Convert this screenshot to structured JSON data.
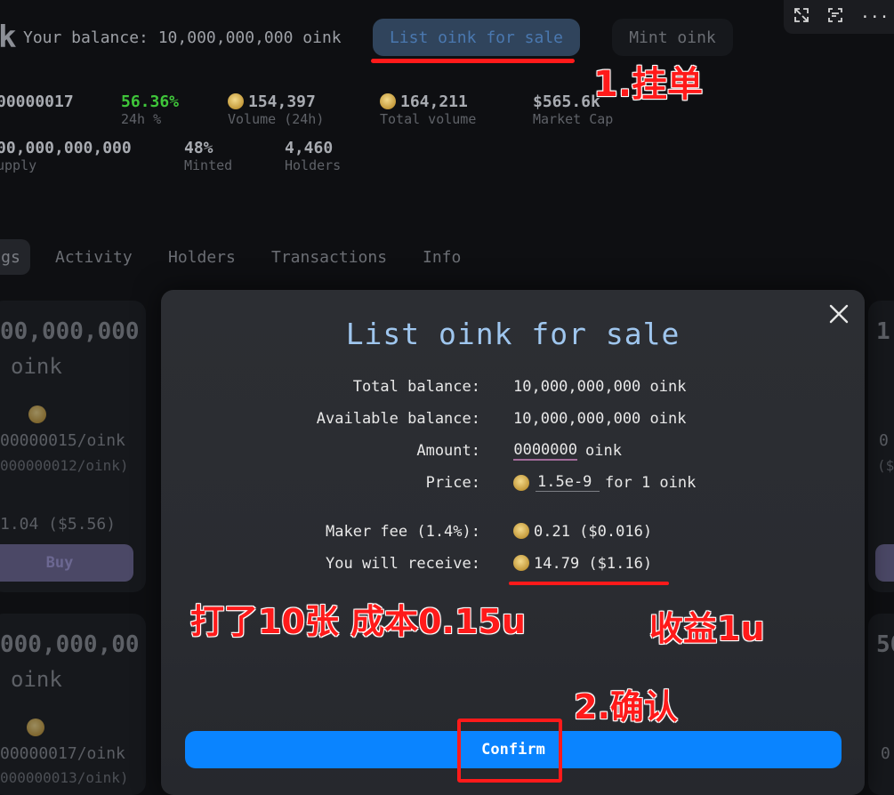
{
  "header": {
    "logo_fragment": "k",
    "balance_text": "Your balance: 10,000,000,000 oink",
    "list_button": "List oink for sale",
    "mint_button": "Mint oink"
  },
  "toolbar": {
    "icons": [
      "expand-icon",
      "scan-text-icon",
      "more-icon"
    ],
    "more_label": "···"
  },
  "stats": {
    "price": "00000017",
    "change_value": "56.36%",
    "change_label": "24h %",
    "volume_value": "154,397",
    "volume_label": "Volume (24h)",
    "total_volume_value": "164,211",
    "total_volume_label": "Total volume",
    "market_cap_value": "$565.6k",
    "market_cap_label": "Market Cap",
    "supply_value": "00,000,000,000",
    "supply_label": "upply",
    "minted_value": "48%",
    "minted_label": "Minted",
    "holders_value": "4,460",
    "holders_label": "Holders"
  },
  "tabs": [
    "gs",
    "Activity",
    "Holders",
    "Transactions",
    "Info"
  ],
  "cards": {
    "card1": {
      "amount": "00,000,000",
      "unit": "oink",
      "price": "00000015/oink",
      "price_usd": "000000012/oink)",
      "total": "1.04 ($5.56)",
      "buy": "Buy"
    },
    "card2": {
      "amount": "000,000,00",
      "unit": "oink",
      "price": "00000017/oink",
      "price_usd": "000000013/oink)"
    },
    "right1": {
      "amount": "1",
      "price": "0",
      "price_usd": "($"
    },
    "right2": {
      "amount": "50",
      "price": "0"
    }
  },
  "modal": {
    "title": "List oink for sale",
    "total_balance_label": "Total balance:",
    "total_balance_value": "10,000,000,000 oink",
    "available_balance_label": "Available balance:",
    "available_balance_value": "10,000,000,000 oink",
    "amount_label": "Amount:",
    "amount_value": "0000000",
    "amount_unit": "oink",
    "price_label": "Price:",
    "price_value": "1.5e-9",
    "price_suffix": "for 1 oink",
    "maker_fee_label": "Maker fee (1.4%):",
    "maker_fee_value": "0.21 ($0.016)",
    "receive_label": "You will receive:",
    "receive_value": "14.79 ($1.16)",
    "confirm": "Confirm"
  },
  "annotations": {
    "step1": "1.挂单",
    "cost": "打了10张 成本0.15u",
    "profit": "收益1u",
    "step2": "2.确认"
  },
  "colors": {
    "accent_blue": "#0a84ff",
    "title_blue": "#9fc6ee",
    "positive_green": "#3fc53a",
    "annotation_red": "#ff1a1a"
  }
}
